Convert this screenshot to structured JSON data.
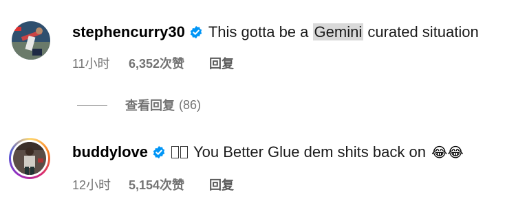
{
  "comments": [
    {
      "username": "stephencurry30",
      "text_before": "This gotta be a ",
      "text_highlight": "Gemini",
      "text_after": " curated situation",
      "time": "11小时",
      "likes": "6,352次赞",
      "reply_label": "回复"
    },
    {
      "username": "buddylove",
      "text": "You Better Glue dem shits back on",
      "emoji": "😂😂",
      "time": "12小时",
      "likes": "5,154次赞",
      "reply_label": "回复"
    }
  ],
  "view_replies": {
    "label": "查看回复",
    "count": "(86)"
  },
  "colors": {
    "verified": "#0095f6",
    "meta_text": "#737373"
  },
  "icons": [
    "verified-badge-icon",
    "avatar"
  ]
}
